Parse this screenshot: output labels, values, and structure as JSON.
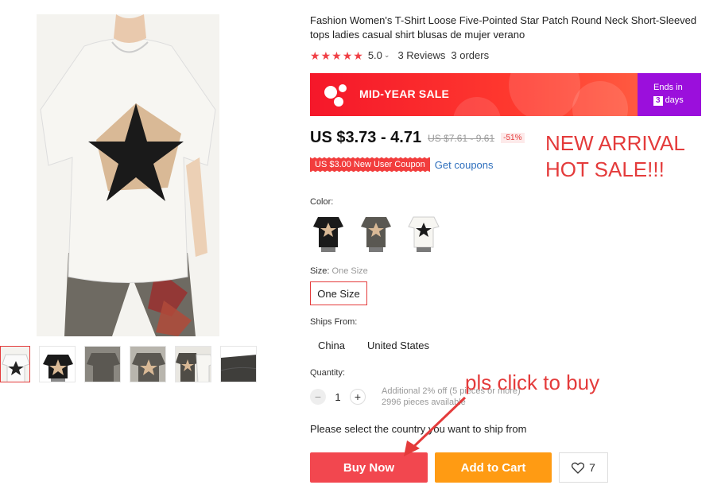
{
  "product": {
    "title": "Fashion Women's T-Shirt Loose Five-Pointed Star Patch Round Neck Short-Sleeved tops ladies casual shirt blusas de mujer verano",
    "rating": "5.0",
    "rating_chevron": "⌄",
    "reviews": "3 Reviews",
    "orders": "3 orders"
  },
  "banner": {
    "sale_label": "MID-YEAR SALE",
    "ends_label": "Ends in",
    "days_num": "3",
    "days_label": "days"
  },
  "price": {
    "current": "US $3.73 - 4.71",
    "original": "US $7.61 - 9.61",
    "discount": "-51%"
  },
  "coupon": {
    "label": "US $3.00 New User Coupon",
    "link": "Get coupons"
  },
  "promo_overlay": {
    "line1": "NEW ARRIVAL",
    "line2": "HOT SALE!!!"
  },
  "options": {
    "color_label": "Color:",
    "size_label": "Size:",
    "size_selected": "One Size",
    "size_option": "One Size",
    "ships_label": "Ships From:",
    "ships_options": [
      "China",
      "United States"
    ]
  },
  "quantity": {
    "label": "Quantity:",
    "minus": "−",
    "plus": "+",
    "value": "1",
    "info_line1": "Additional 2% off (5 pieces or more)",
    "info_line2": "2996 pieces available"
  },
  "ship_note": "Please select the country you want to ship from",
  "actions": {
    "buy_now": "Buy Now",
    "add_to_cart": "Add to Cart",
    "wishlist_count": "7"
  },
  "annotation": "pls click to buy",
  "colors": {
    "accent": "#e43b3b",
    "buy": "#f2474f",
    "cart": "#ff9b13",
    "banner_purple": "#9b0fdc"
  },
  "icons": [
    "star-icon",
    "heart-icon",
    "sale-logo-icon",
    "arrow-annotation"
  ]
}
